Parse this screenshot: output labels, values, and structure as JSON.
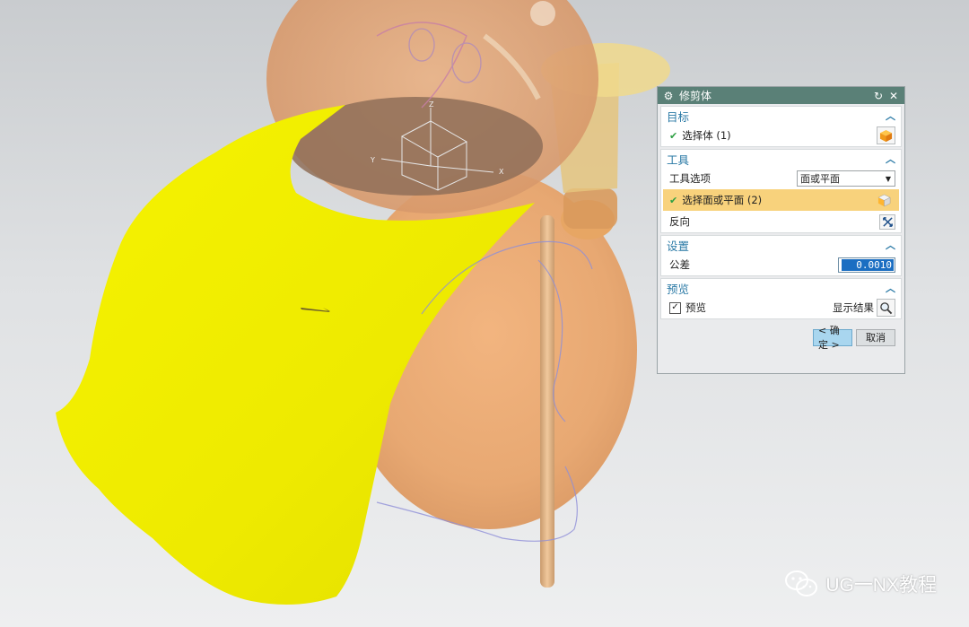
{
  "dialog": {
    "title": "修剪体",
    "sections": {
      "target": {
        "label": "目标",
        "select_body": "选择体 (1)"
      },
      "tool": {
        "label": "工具",
        "tool_option_label": "工具选项",
        "tool_option_value": "面或平面",
        "select_face": "选择面或平面 (2)",
        "reverse": "反向"
      },
      "settings": {
        "label": "设置",
        "tolerance_label": "公差",
        "tolerance_value": "0.0010"
      },
      "preview": {
        "label": "预览",
        "preview_checkbox": "预览",
        "show_result": "显示结果"
      }
    },
    "ok_label": "< 确定 >",
    "cancel_label": "取消"
  },
  "viewport": {
    "axes": {
      "x": "X",
      "y": "Y",
      "z": "Z"
    }
  },
  "watermark": {
    "text": "UG一NX教程"
  },
  "colors": {
    "title_bar": "#5a8077",
    "section_header": "#2b7aa6",
    "highlight_row": "#f8d27c",
    "surface_yellow": "#f2f000"
  }
}
